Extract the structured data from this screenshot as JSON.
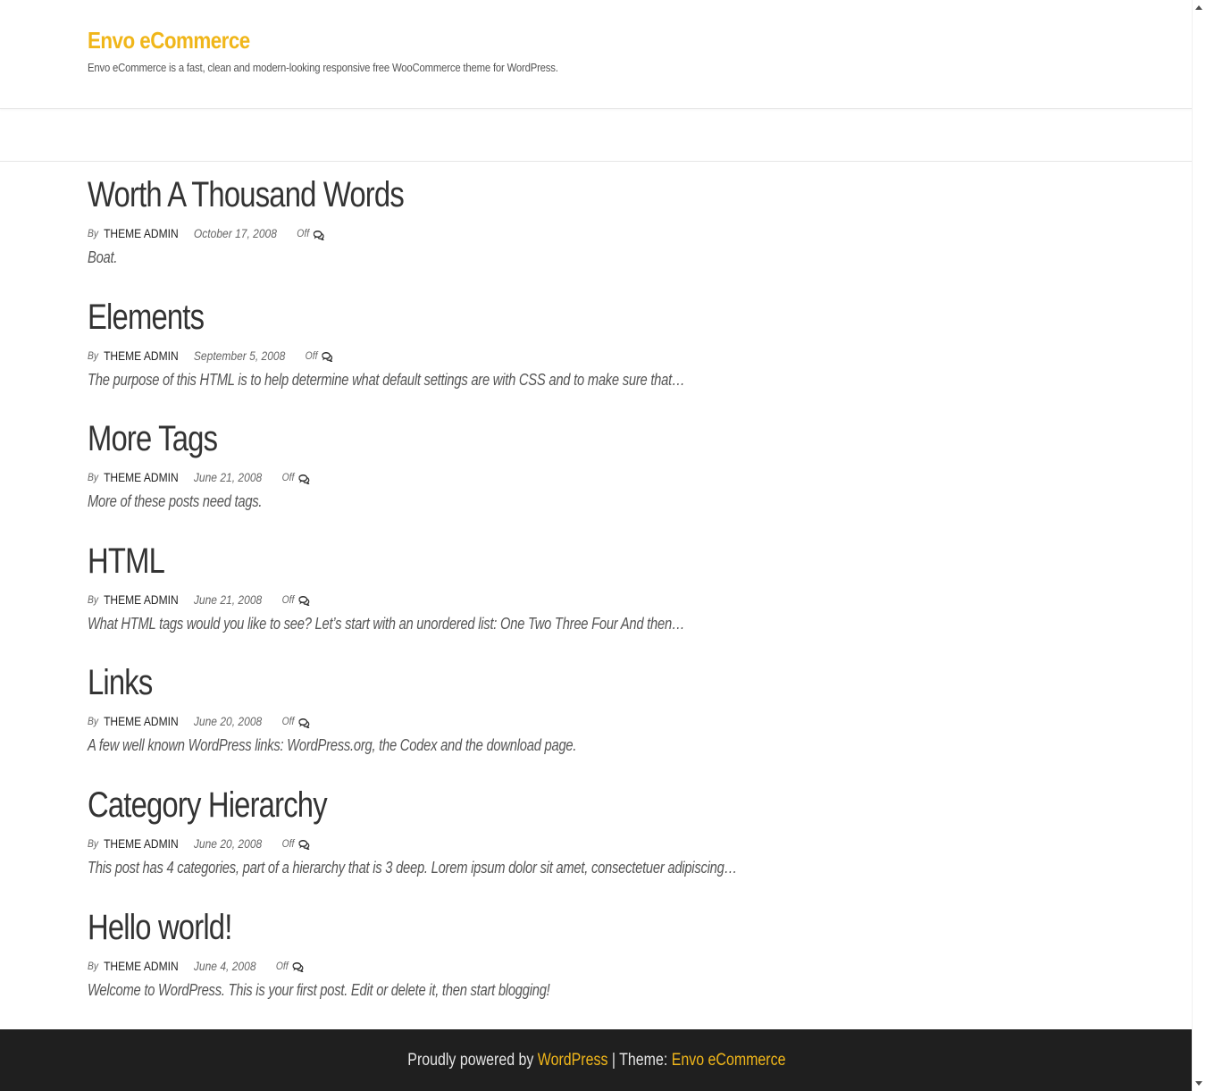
{
  "site": {
    "title": "Envo eCommerce",
    "description": "Envo eCommerce is a fast, clean and modern-looking responsive free WooCommerce theme for WordPress."
  },
  "posts": [
    {
      "title": "Worth A Thousand Words",
      "by": "By",
      "author": "THEME ADMIN",
      "date": "October 17, 2008",
      "comments": "Off",
      "excerpt": "Boat."
    },
    {
      "title": "Elements",
      "by": "By",
      "author": "THEME ADMIN",
      "date": "September 5, 2008",
      "comments": "Off",
      "excerpt": "The purpose of this HTML is to help determine what default settings are with CSS and to make sure that…"
    },
    {
      "title": "More Tags",
      "by": "By",
      "author": "THEME ADMIN",
      "date": "June 21, 2008",
      "comments": "Off",
      "excerpt": "More of these posts need tags."
    },
    {
      "title": "HTML",
      "by": "By",
      "author": "THEME ADMIN",
      "date": "June 21, 2008",
      "comments": "Off",
      "excerpt": "What HTML tags would you like to see? Let’s start with an unordered list: One Two Three Four And then…"
    },
    {
      "title": "Links",
      "by": "By",
      "author": "THEME ADMIN",
      "date": "June 20, 2008",
      "comments": "Off",
      "excerpt": "A few well known WordPress links: WordPress.org, the Codex and the download page."
    },
    {
      "title": "Category Hierarchy",
      "by": "By",
      "author": "THEME ADMIN",
      "date": "June 20, 2008",
      "comments": "Off",
      "excerpt": "This post has 4 categories, part of a hierarchy that is 3 deep. Lorem ipsum dolor sit amet, consectetuer adipiscing…"
    },
    {
      "title": "Hello world!",
      "by": "By",
      "author": "THEME ADMIN",
      "date": "June 4, 2008",
      "comments": "Off",
      "excerpt": "Welcome to WordPress. This is your first post. Edit or delete it, then start blogging!"
    }
  ],
  "footer": {
    "powered_text": "Proudly powered by",
    "wordpress_link": "WordPress",
    "separator": "|",
    "theme_text": "Theme:",
    "theme_link": "Envo eCommerce"
  },
  "icons": {
    "comments": "comments-icon"
  },
  "colors": {
    "accent": "#f0b61a",
    "footer_bg": "#1f1f1f",
    "text": "#333333"
  }
}
